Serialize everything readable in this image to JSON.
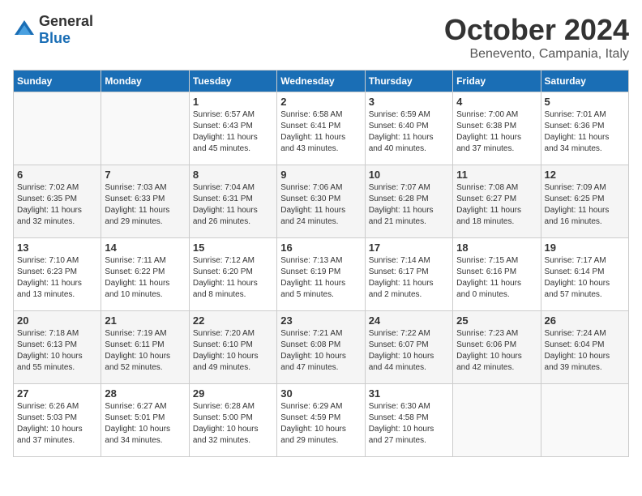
{
  "logo": {
    "general": "General",
    "blue": "Blue"
  },
  "title": "October 2024",
  "location": "Benevento, Campania, Italy",
  "weekdays": [
    "Sunday",
    "Monday",
    "Tuesday",
    "Wednesday",
    "Thursday",
    "Friday",
    "Saturday"
  ],
  "weeks": [
    [
      {
        "day": "",
        "info": ""
      },
      {
        "day": "",
        "info": ""
      },
      {
        "day": "1",
        "info": "Sunrise: 6:57 AM\nSunset: 6:43 PM\nDaylight: 11 hours\nand 45 minutes."
      },
      {
        "day": "2",
        "info": "Sunrise: 6:58 AM\nSunset: 6:41 PM\nDaylight: 11 hours\nand 43 minutes."
      },
      {
        "day": "3",
        "info": "Sunrise: 6:59 AM\nSunset: 6:40 PM\nDaylight: 11 hours\nand 40 minutes."
      },
      {
        "day": "4",
        "info": "Sunrise: 7:00 AM\nSunset: 6:38 PM\nDaylight: 11 hours\nand 37 minutes."
      },
      {
        "day": "5",
        "info": "Sunrise: 7:01 AM\nSunset: 6:36 PM\nDaylight: 11 hours\nand 34 minutes."
      }
    ],
    [
      {
        "day": "6",
        "info": "Sunrise: 7:02 AM\nSunset: 6:35 PM\nDaylight: 11 hours\nand 32 minutes."
      },
      {
        "day": "7",
        "info": "Sunrise: 7:03 AM\nSunset: 6:33 PM\nDaylight: 11 hours\nand 29 minutes."
      },
      {
        "day": "8",
        "info": "Sunrise: 7:04 AM\nSunset: 6:31 PM\nDaylight: 11 hours\nand 26 minutes."
      },
      {
        "day": "9",
        "info": "Sunrise: 7:06 AM\nSunset: 6:30 PM\nDaylight: 11 hours\nand 24 minutes."
      },
      {
        "day": "10",
        "info": "Sunrise: 7:07 AM\nSunset: 6:28 PM\nDaylight: 11 hours\nand 21 minutes."
      },
      {
        "day": "11",
        "info": "Sunrise: 7:08 AM\nSunset: 6:27 PM\nDaylight: 11 hours\nand 18 minutes."
      },
      {
        "day": "12",
        "info": "Sunrise: 7:09 AM\nSunset: 6:25 PM\nDaylight: 11 hours\nand 16 minutes."
      }
    ],
    [
      {
        "day": "13",
        "info": "Sunrise: 7:10 AM\nSunset: 6:23 PM\nDaylight: 11 hours\nand 13 minutes."
      },
      {
        "day": "14",
        "info": "Sunrise: 7:11 AM\nSunset: 6:22 PM\nDaylight: 11 hours\nand 10 minutes."
      },
      {
        "day": "15",
        "info": "Sunrise: 7:12 AM\nSunset: 6:20 PM\nDaylight: 11 hours\nand 8 minutes."
      },
      {
        "day": "16",
        "info": "Sunrise: 7:13 AM\nSunset: 6:19 PM\nDaylight: 11 hours\nand 5 minutes."
      },
      {
        "day": "17",
        "info": "Sunrise: 7:14 AM\nSunset: 6:17 PM\nDaylight: 11 hours\nand 2 minutes."
      },
      {
        "day": "18",
        "info": "Sunrise: 7:15 AM\nSunset: 6:16 PM\nDaylight: 11 hours\nand 0 minutes."
      },
      {
        "day": "19",
        "info": "Sunrise: 7:17 AM\nSunset: 6:14 PM\nDaylight: 10 hours\nand 57 minutes."
      }
    ],
    [
      {
        "day": "20",
        "info": "Sunrise: 7:18 AM\nSunset: 6:13 PM\nDaylight: 10 hours\nand 55 minutes."
      },
      {
        "day": "21",
        "info": "Sunrise: 7:19 AM\nSunset: 6:11 PM\nDaylight: 10 hours\nand 52 minutes."
      },
      {
        "day": "22",
        "info": "Sunrise: 7:20 AM\nSunset: 6:10 PM\nDaylight: 10 hours\nand 49 minutes."
      },
      {
        "day": "23",
        "info": "Sunrise: 7:21 AM\nSunset: 6:08 PM\nDaylight: 10 hours\nand 47 minutes."
      },
      {
        "day": "24",
        "info": "Sunrise: 7:22 AM\nSunset: 6:07 PM\nDaylight: 10 hours\nand 44 minutes."
      },
      {
        "day": "25",
        "info": "Sunrise: 7:23 AM\nSunset: 6:06 PM\nDaylight: 10 hours\nand 42 minutes."
      },
      {
        "day": "26",
        "info": "Sunrise: 7:24 AM\nSunset: 6:04 PM\nDaylight: 10 hours\nand 39 minutes."
      }
    ],
    [
      {
        "day": "27",
        "info": "Sunrise: 6:26 AM\nSunset: 5:03 PM\nDaylight: 10 hours\nand 37 minutes."
      },
      {
        "day": "28",
        "info": "Sunrise: 6:27 AM\nSunset: 5:01 PM\nDaylight: 10 hours\nand 34 minutes."
      },
      {
        "day": "29",
        "info": "Sunrise: 6:28 AM\nSunset: 5:00 PM\nDaylight: 10 hours\nand 32 minutes."
      },
      {
        "day": "30",
        "info": "Sunrise: 6:29 AM\nSunset: 4:59 PM\nDaylight: 10 hours\nand 29 minutes."
      },
      {
        "day": "31",
        "info": "Sunrise: 6:30 AM\nSunset: 4:58 PM\nDaylight: 10 hours\nand 27 minutes."
      },
      {
        "day": "",
        "info": ""
      },
      {
        "day": "",
        "info": ""
      }
    ]
  ]
}
